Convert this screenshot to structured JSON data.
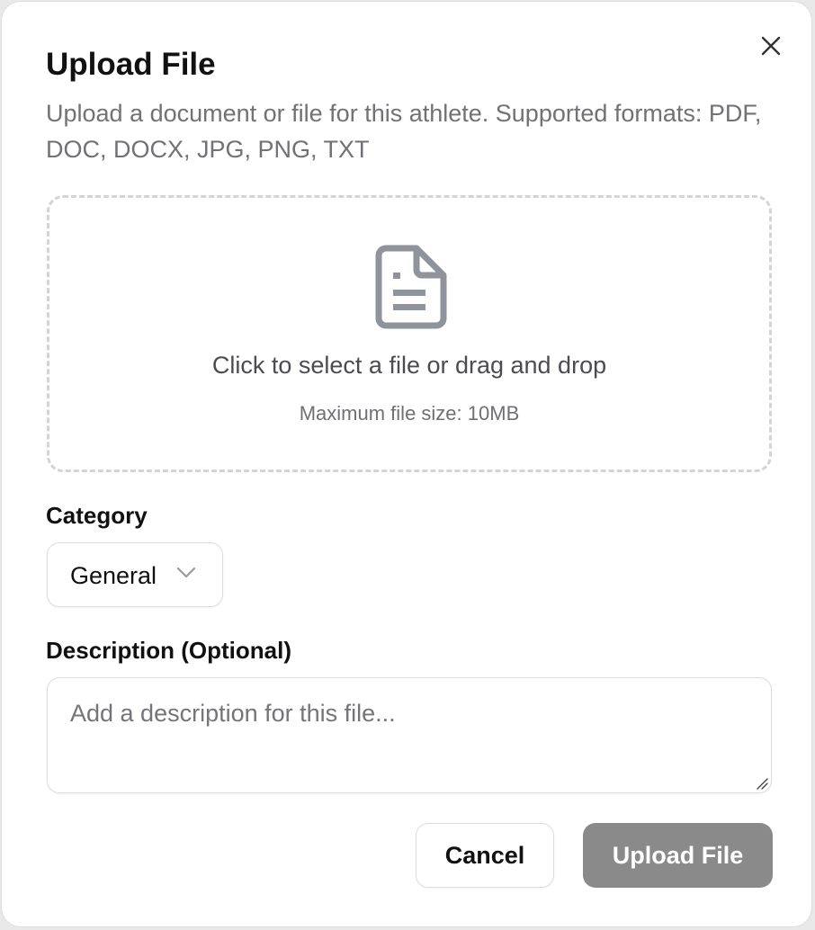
{
  "dialog": {
    "title": "Upload File",
    "subtitle": "Upload a document or file for this athlete. Supported formats: PDF, DOC, DOCX, JPG, PNG, TXT",
    "close_icon": "close-icon"
  },
  "dropzone": {
    "icon": "file-icon",
    "main_text": "Click to select a file or drag and drop",
    "size_hint": "Maximum file size: 10MB"
  },
  "category": {
    "label": "Category",
    "selected": "General",
    "icon": "chevron-down-icon"
  },
  "description": {
    "label": "Description (Optional)",
    "value": "",
    "placeholder": "Add a description for this file..."
  },
  "actions": {
    "cancel_label": "Cancel",
    "upload_label": "Upload File"
  },
  "colors": {
    "upload_button_bg": "#8a8a8a",
    "icon_gray": "#8f939c",
    "subtitle_text": "#717176"
  }
}
